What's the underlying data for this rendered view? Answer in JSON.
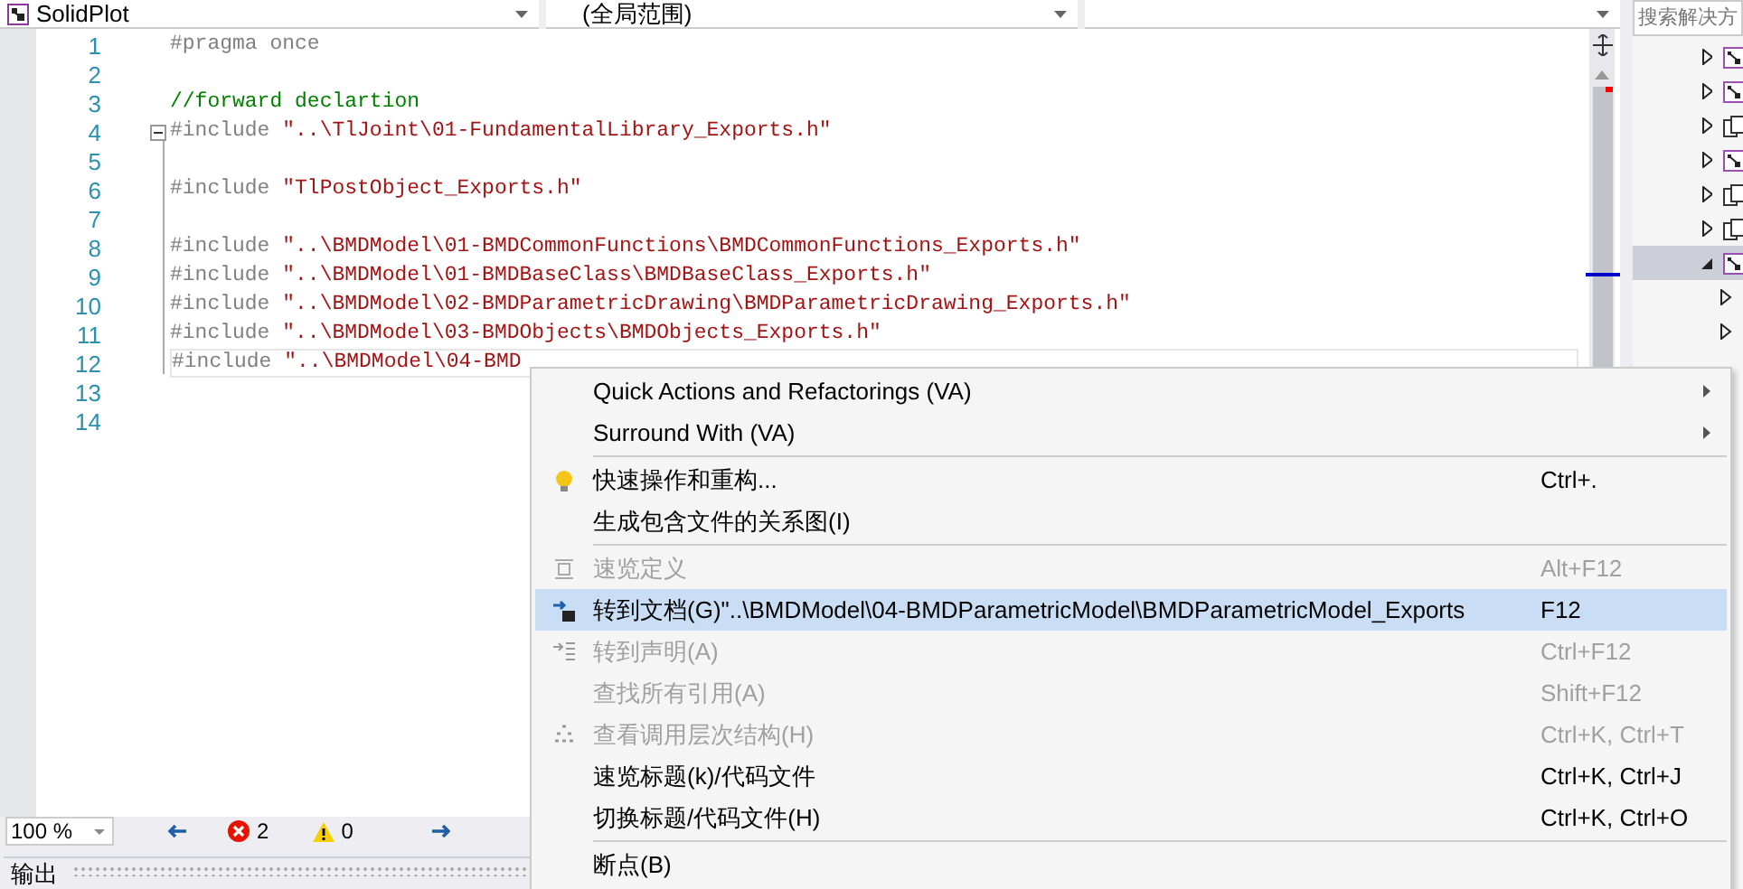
{
  "nav_bar": {
    "project": "SolidPlot",
    "scope": "(全局范围)"
  },
  "editor": {
    "lines": [
      {
        "number": "1",
        "kind": "directive",
        "directive": "#pragma once"
      },
      {
        "number": "2",
        "kind": "blank"
      },
      {
        "number": "3",
        "kind": "comment",
        "comment": "//forward declartion"
      },
      {
        "number": "4",
        "kind": "include",
        "directive": "#include",
        "string": "\"..\\TlJoint\\01-FundamentalLibrary_Exports.h\"",
        "fold": true
      },
      {
        "number": "5",
        "kind": "blank"
      },
      {
        "number": "6",
        "kind": "include",
        "directive": "#include",
        "string": "\"TlPostObject_Exports.h\""
      },
      {
        "number": "7",
        "kind": "blank"
      },
      {
        "number": "8",
        "kind": "include",
        "directive": "#include",
        "string": "\"..\\BMDModel\\01-BMDCommonFunctions\\BMDCommonFunctions_Exports.h\""
      },
      {
        "number": "9",
        "kind": "include",
        "directive": "#include",
        "string": "\"..\\BMDModel\\01-BMDBaseClass\\BMDBaseClass_Exports.h\""
      },
      {
        "number": "10",
        "kind": "include",
        "directive": "#include",
        "string": "\"..\\BMDModel\\02-BMDParametricDrawing\\BMDParametricDrawing_Exports.h\""
      },
      {
        "number": "11",
        "kind": "include",
        "directive": "#include",
        "string": "\"..\\BMDModel\\03-BMDObjects\\BMDObjects_Exports.h\""
      },
      {
        "number": "12",
        "kind": "include",
        "directive": "#include",
        "string": "\"..\\BMDModel\\04-BMD",
        "current": true
      },
      {
        "number": "13",
        "kind": "blank"
      },
      {
        "number": "14",
        "kind": "blank"
      }
    ]
  },
  "status_bar": {
    "zoom": "100 %",
    "errors": "2",
    "warnings": "0"
  },
  "output_panel": {
    "title": "输出"
  },
  "solution_explorer": {
    "search_placeholder": "搜索解决方",
    "items": [
      {
        "kind": "project",
        "expanded": false,
        "selected": false
      },
      {
        "kind": "project",
        "expanded": false,
        "selected": false
      },
      {
        "kind": "shared",
        "expanded": false,
        "selected": false
      },
      {
        "kind": "project",
        "expanded": false,
        "selected": false
      },
      {
        "kind": "shared",
        "expanded": false,
        "selected": false
      },
      {
        "kind": "shared",
        "expanded": false,
        "selected": false
      },
      {
        "kind": "project",
        "expanded": true,
        "selected": true,
        "children": [
          {
            "expanded": false,
            "selected": false
          },
          {
            "expanded": false,
            "selected": false
          }
        ]
      }
    ]
  },
  "context_menu": [
    {
      "kind": "submenu",
      "label": "Quick Actions and Refactorings (VA)",
      "disabled": false,
      "selected": false
    },
    {
      "kind": "submenu",
      "label": "Surround With (VA)",
      "disabled": false,
      "selected": false
    },
    {
      "kind": "separator"
    },
    {
      "kind": "lightbulb",
      "label": "快速操作和重构...",
      "shortcut": "Ctrl+.",
      "disabled": false,
      "selected": false
    },
    {
      "kind": "plain",
      "label": "生成包含文件的关系图(I)",
      "disabled": false,
      "selected": false
    },
    {
      "kind": "separator"
    },
    {
      "kind": "peek",
      "label": "速览定义",
      "shortcut": "Alt+F12",
      "disabled": true,
      "selected": false
    },
    {
      "kind": "goto",
      "label": "转到文档(G)\"..\\BMDModel\\04-BMDParametricModel\\BMDParametricModel_Exports",
      "shortcut": "F12",
      "disabled": false,
      "selected": true
    },
    {
      "kind": "declaration",
      "label": "转到声明(A)",
      "shortcut": "Ctrl+F12",
      "disabled": true,
      "selected": false
    },
    {
      "kind": "plain",
      "label": "查找所有引用(A)",
      "shortcut": "Shift+F12",
      "disabled": true,
      "selected": false
    },
    {
      "kind": "hierarchy",
      "label": "查看调用层次结构(H)",
      "shortcut": "Ctrl+K, Ctrl+T",
      "disabled": true,
      "selected": false
    },
    {
      "kind": "plain",
      "label": "速览标题(k)/代码文件",
      "shortcut": "Ctrl+K, Ctrl+J",
      "disabled": false,
      "selected": false
    },
    {
      "kind": "plain",
      "label": "切换标题/代码文件(H)",
      "shortcut": "Ctrl+K, Ctrl+O",
      "disabled": false,
      "selected": false
    },
    {
      "kind": "separator"
    },
    {
      "kind": "plain",
      "label": "断点(B)",
      "disabled": false,
      "selected": false
    }
  ]
}
